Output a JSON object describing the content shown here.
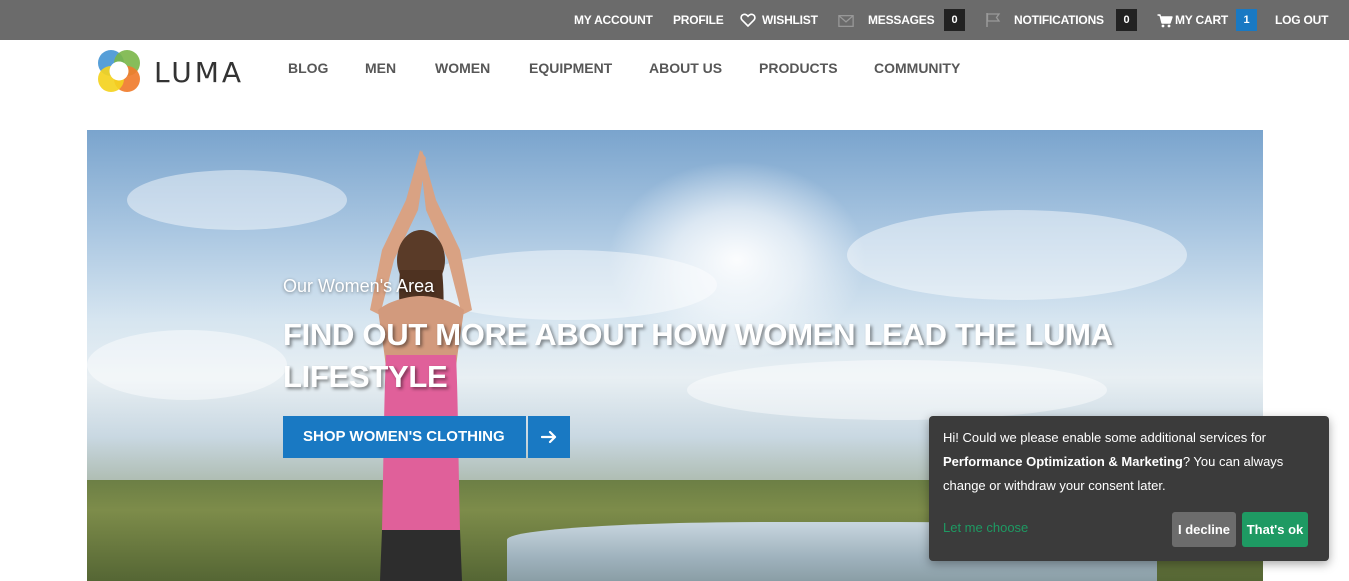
{
  "topbar": {
    "my_account": "My Account",
    "profile": "Profile",
    "wishlist": "Wishlist",
    "messages": "Messages",
    "messages_count": "0",
    "notifications": "Notifications",
    "notifications_count": "0",
    "my_cart": "My Cart",
    "cart_count": "1",
    "log_out": "Log Out",
    "icons": {
      "wishlist": "heart-icon",
      "messages": "envelope-icon",
      "notifications": "flag-icon",
      "cart": "cart-icon"
    }
  },
  "header": {
    "logo_text": "LUMA",
    "nav": [
      "Blog",
      "Men",
      "Women",
      "Equipment",
      "About Us",
      "Products",
      "Community"
    ]
  },
  "hero": {
    "subtitle": "Our Women's Area",
    "title": "Find out more about how women lead the LUMA lifestyle",
    "button_label": "Shop Women's Clothing",
    "button_icon": "arrow-right-icon"
  },
  "consent": {
    "text_before": "Hi! Could we please enable some additional services for ",
    "text_bold": "Performance Optimization & Marketing",
    "text_after": "? You can always change or withdraw your consent later.",
    "choose_label": "Let me choose",
    "decline_label": "I decline",
    "ok_label": "That's ok"
  },
  "colors": {
    "topbar_bg": "#6b6b6b",
    "accent_blue": "#1979c3",
    "consent_bg": "#3b3b3b",
    "consent_green": "#1e9a63"
  }
}
